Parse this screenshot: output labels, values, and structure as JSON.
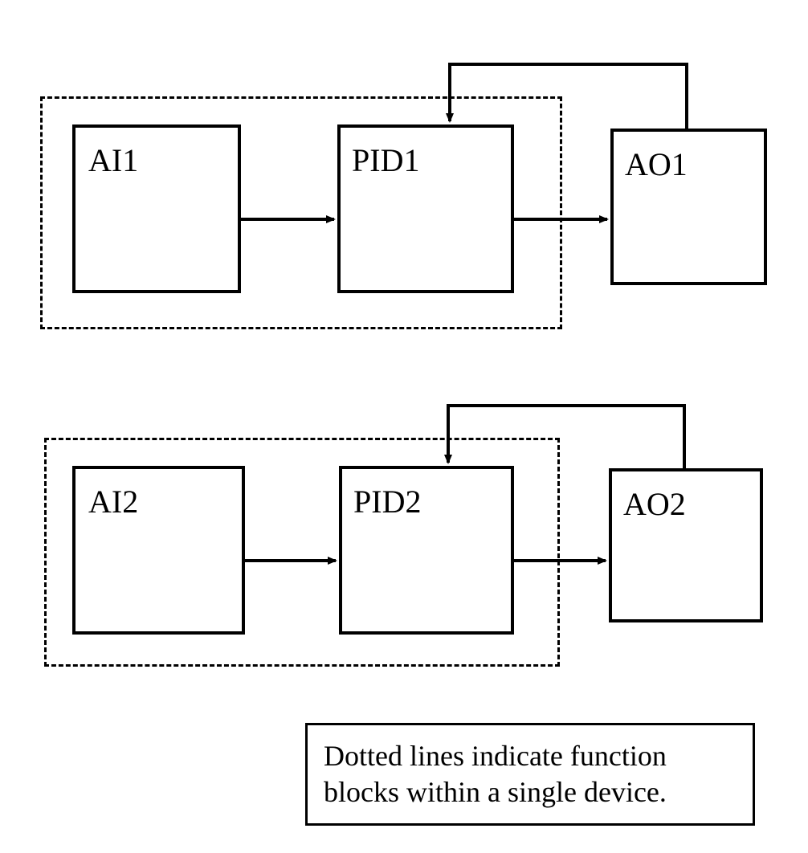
{
  "loop1": {
    "ai_label": "AI1",
    "pid_label": "PID1",
    "ao_label": "AO1"
  },
  "loop2": {
    "ai_label": "AI2",
    "pid_label": "PID2",
    "ao_label": "AO2"
  },
  "note": {
    "line1": "Dotted lines indicate function",
    "line2": "blocks within a single device."
  }
}
